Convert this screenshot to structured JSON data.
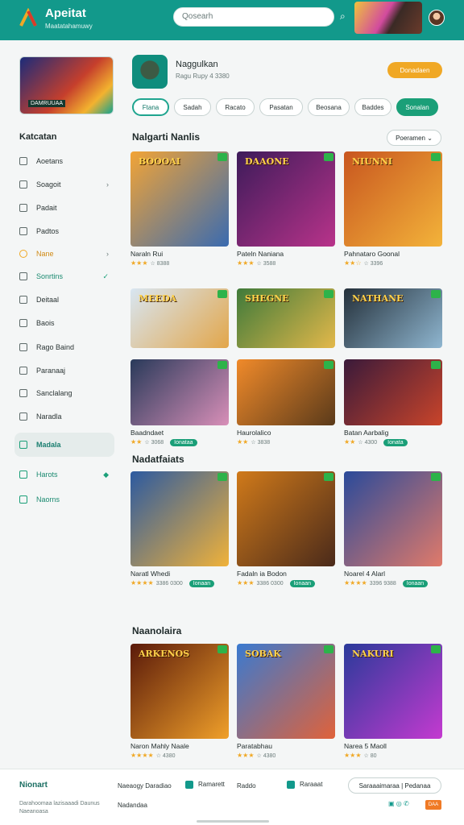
{
  "header": {
    "brand": "Apeitat",
    "brand_sub": "Maatatahamuwy",
    "search_placeholder": "Qosearh"
  },
  "sidebar": {
    "banner_label": "DAMRUUAA",
    "title": "Katcatan",
    "items": [
      {
        "label": "Aoetans"
      },
      {
        "label": "Soagoit",
        "chevron": "›"
      },
      {
        "label": "Padait"
      },
      {
        "label": "Padtos"
      },
      {
        "label": "Nane",
        "chevron": "›"
      },
      {
        "label": "Sonrtins",
        "chevron": "✓"
      },
      {
        "label": "Deitaal"
      },
      {
        "label": "Baois"
      },
      {
        "label": "Rago Baind"
      },
      {
        "label": "Paranaaj"
      },
      {
        "label": "Sanclalang"
      },
      {
        "label": "Naradla"
      },
      {
        "label": "Madala"
      },
      {
        "label": "Harots",
        "chevron": "◆"
      },
      {
        "label": "Naorns"
      }
    ]
  },
  "main": {
    "game_title": "Naggulkan",
    "game_sub": "Ragu Rupy 4 3380",
    "play_label": "Donadaen",
    "chips": [
      "Ftana",
      "Sadah",
      "Racato",
      "Pasatan",
      "Beosana",
      "Baddes",
      "Sonalan"
    ],
    "section1": "Nalgarti Nanlis",
    "sort_label": "Poeramen",
    "section2": "Nadatfaiats",
    "section3": "Naanolaira"
  },
  "cards": [
    {
      "title": "Naraln Rui",
      "meta": "☆ 8388",
      "stars": "★★★",
      "art": "BOOOAI"
    },
    {
      "title": "Pateln Naniana",
      "meta": "☆ 3588",
      "stars": "★★★",
      "art": "DAAONE"
    },
    {
      "title": "Pahnataro Goonal",
      "meta": "☆ 3396",
      "stars": "★★☆",
      "art": "NIUNNI"
    },
    {
      "title": "",
      "meta": "",
      "stars": "",
      "art": "MEEDA"
    },
    {
      "title": "",
      "meta": "",
      "stars": "",
      "art": "SHEGNE"
    },
    {
      "title": "",
      "meta": "",
      "stars": "",
      "art": "NATHANE"
    },
    {
      "title": "Baadndaet",
      "meta": "☆ 3068",
      "stars": "★★",
      "btn": "Ionataa"
    },
    {
      "title": "Haurolalico",
      "meta": "☆ 3838",
      "stars": "★★",
      "btn": ""
    },
    {
      "title": "Batan Aarbalig",
      "meta": "☆ 4300",
      "stars": "★★",
      "btn": "Ionata"
    },
    {
      "title": "Naratl Whedi",
      "meta": "3386 0300",
      "stars": "★★★★",
      "btn": "Ionaan"
    },
    {
      "title": "Fadaln ia Bodon",
      "meta": "3386 0300",
      "stars": "★★★",
      "btn": "Ionaan"
    },
    {
      "title": "Noarel 4 Alarl",
      "meta": "3396 9388",
      "stars": "★★★★",
      "btn": "Ionaan"
    },
    {
      "title": "Naron Mahly Naale",
      "meta": "☆ 4380",
      "stars": "★★★★",
      "art": "ARKENOS"
    },
    {
      "title": "Paratabhau",
      "meta": "☆ 4380",
      "stars": "★★★",
      "art": "SOBAK"
    },
    {
      "title": "Narea 5 Maoll",
      "meta": "☆ 80",
      "stars": "★★★",
      "art": "NAKURI"
    }
  ],
  "footer": {
    "title": "Nionart",
    "desc": "Darahoomaa lazisaaadi Daunus Naeanoasa",
    "links": [
      "Naeaogy Daradiao",
      "Ramarett",
      "Raddo",
      "Raraaat",
      "Nadandaa"
    ],
    "input_placeholder": "Saraaaimaraa | Pedanaa",
    "social": "▣ ◎ ✆",
    "badge": "DAA"
  },
  "colors": {
    "accent": "#12998b",
    "button": "#1a9f78",
    "play": "#f0a825"
  }
}
